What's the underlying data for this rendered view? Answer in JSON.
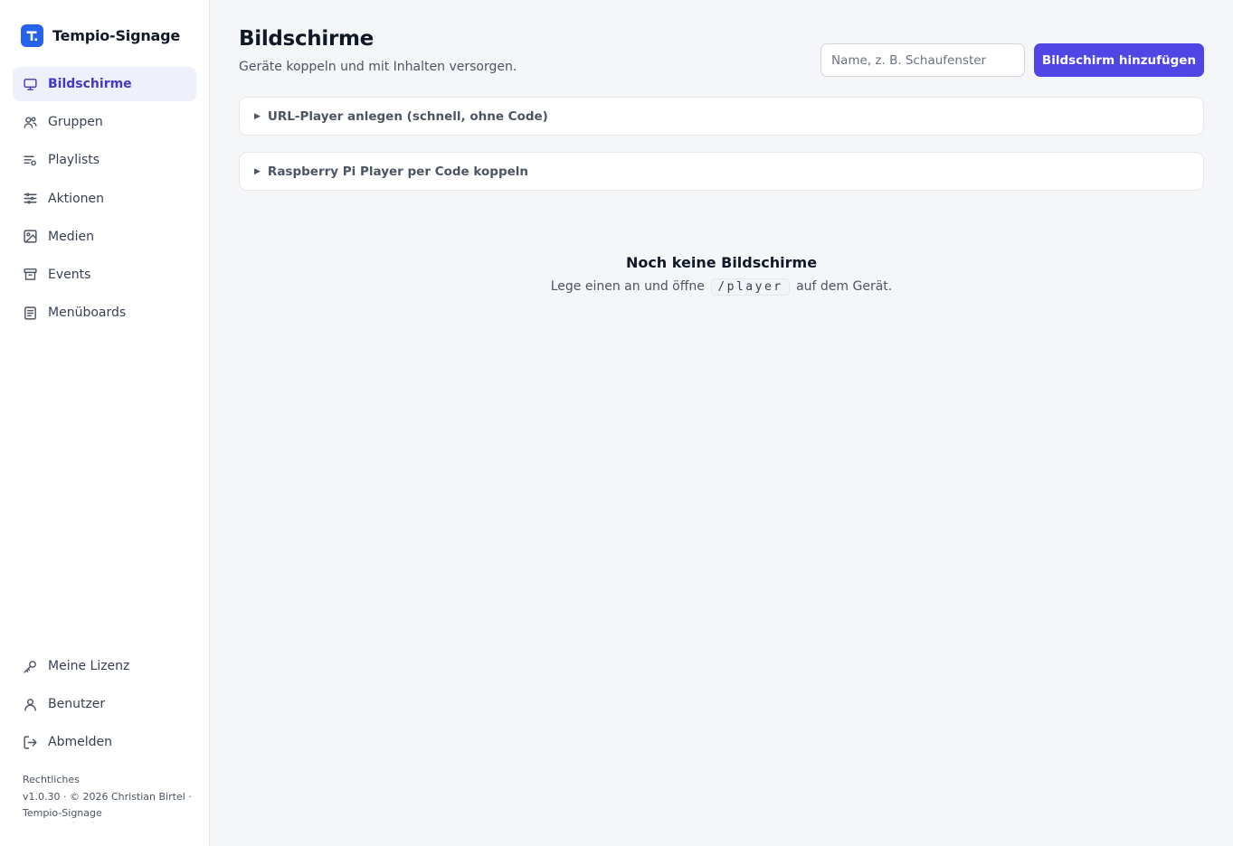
{
  "app": {
    "name": "Tempio-Signage",
    "brand_color": "#2563eb",
    "accent_color": "#4f46e5"
  },
  "sidebar": {
    "items": [
      {
        "label": "Bildschirme",
        "icon": "monitor-icon",
        "active": true
      },
      {
        "label": "Gruppen",
        "icon": "users-icon"
      },
      {
        "label": "Playlists",
        "icon": "playlist-icon"
      },
      {
        "label": "Aktionen",
        "icon": "sliders-icon"
      },
      {
        "label": "Medien",
        "icon": "image-icon"
      },
      {
        "label": "Events",
        "icon": "archive-icon"
      },
      {
        "label": "Menüboards",
        "icon": "document-icon"
      }
    ],
    "bottom_items": [
      {
        "label": "Meine Lizenz",
        "icon": "key-icon"
      },
      {
        "label": "Benutzer",
        "icon": "user-icon"
      },
      {
        "label": "Abmelden",
        "icon": "logout-icon"
      }
    ],
    "footer": {
      "legal_link": "Rechtliches",
      "version": "v1.0.30 · © 2026 Christian Birtel ·",
      "product": "Tempio-Signage"
    }
  },
  "header": {
    "title": "Bildschirme",
    "subtitle": "Geräte koppeln und mit Inhalten versorgen.",
    "name_input": {
      "placeholder": "Name, z. B. Schaufenster",
      "value": ""
    },
    "add_button_label": "Bildschirm hinzufügen"
  },
  "sections": [
    {
      "label": "URL-Player anlegen (schnell, ohne Code)",
      "expanded": false
    },
    {
      "label": "Raspberry Pi Player per Code koppeln",
      "expanded": false
    }
  ],
  "empty_state": {
    "title": "Noch keine Bildschirme",
    "text_before": "Lege einen an und öffne",
    "code": "/player",
    "text_after": "auf dem Gerät."
  }
}
